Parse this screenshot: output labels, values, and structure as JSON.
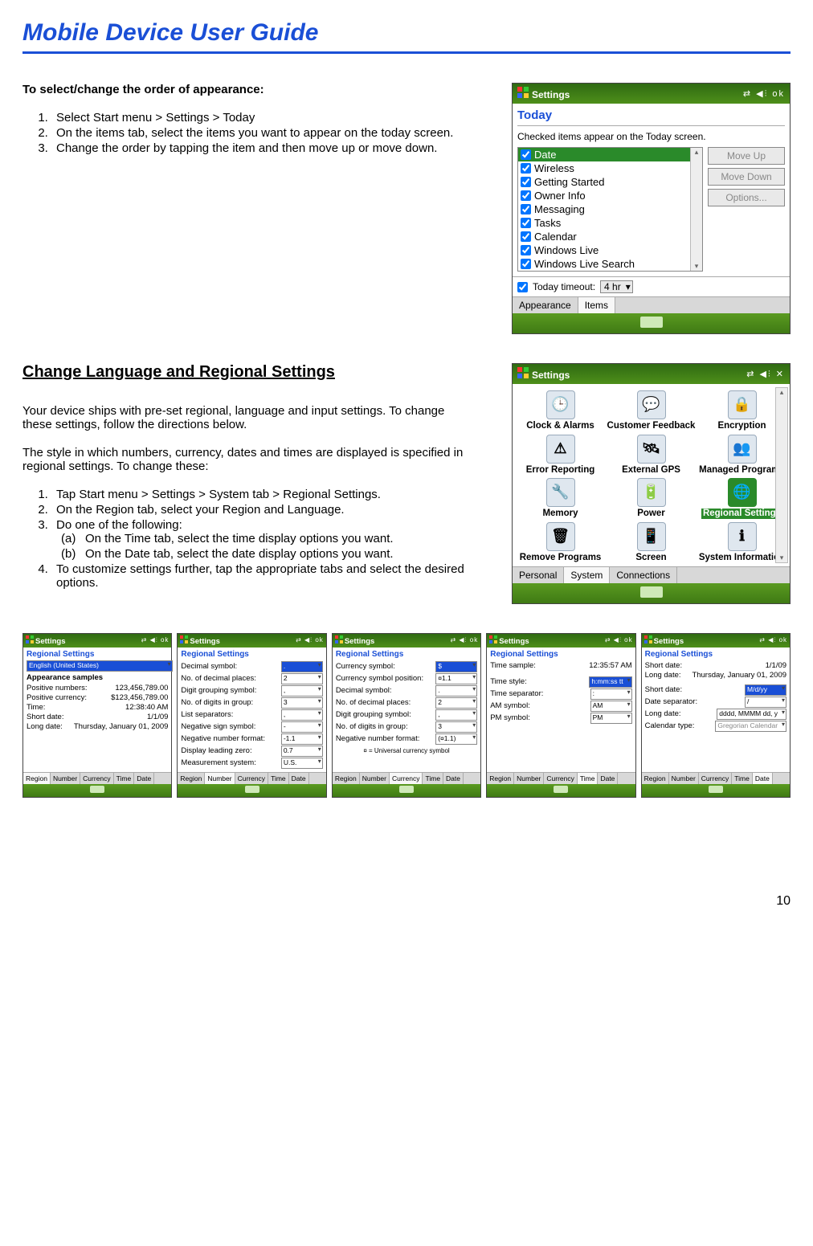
{
  "page": {
    "title": "Mobile Device User Guide",
    "number": "10"
  },
  "section1": {
    "heading": "To select/change the order of appearance:",
    "steps": [
      "Select Start menu > Settings > Today",
      "On the items tab, select the items you want to appear on the today screen.",
      "Change the order by tapping the item and then move up or move down."
    ]
  },
  "device1": {
    "title": "Settings",
    "rightIcons": "⇄  ◀⫶  ok",
    "subtitle": "Today",
    "caption": "Checked items appear on the Today screen.",
    "items": [
      "Date",
      "Wireless",
      "Getting Started",
      "Owner Info",
      "Messaging",
      "Tasks",
      "Calendar",
      "Windows Live",
      "Windows Live Search"
    ],
    "buttons": [
      "Move Up",
      "Move Down",
      "Options..."
    ],
    "footerLabel": "Today timeout:",
    "footerValue": "4 hr",
    "tabs": [
      "Appearance",
      "Items"
    ]
  },
  "section2": {
    "heading": "Change Language and Regional Settings",
    "p1": "Your device ships with pre-set regional, language and input settings. To change",
    "p1b": "these settings, follow the directions below.",
    "p2": "The style in which numbers, currency, dates and times are displayed is specified in regional settings. To change these:",
    "steps": [
      "Tap Start menu > Settings > System tab > Regional Settings.",
      "On the Region tab, select your Region and Language.",
      "Do one of the following:",
      "To customize settings further, tap the appropriate tabs and select the desired options."
    ],
    "substeps": [
      {
        "label": "(a)",
        "text": "On the Time tab, select the time display options you want."
      },
      {
        "label": "(b)",
        "text": "On the Date tab, select the date display options you want."
      }
    ]
  },
  "device2": {
    "title": "Settings",
    "rightIcons": "⇄  ◀⫶  ✕",
    "grid": [
      "Clock & Alarms",
      "Customer Feedback",
      "Encryption",
      "Error Reporting",
      "External GPS",
      "Managed Programs",
      "Memory",
      "Power",
      "Regional Settings",
      "Remove Programs",
      "Screen",
      "System Information"
    ],
    "gridIcons": [
      "🕒",
      "💬",
      "🔒",
      "⚠",
      "🛰",
      "👥",
      "🔧",
      "🔋",
      "🌐",
      "🗑",
      "📱",
      "ℹ"
    ],
    "tabs": [
      "Personal",
      "System",
      "Connections"
    ]
  },
  "shots": {
    "common": {
      "title": "Settings",
      "rightIcons": "⇄ ◀⫶ ok",
      "subtitle": "Regional Settings",
      "tabs": [
        "Region",
        "Number",
        "Currency",
        "Time",
        "Date"
      ]
    },
    "s1": {
      "dropdown": "English (United States)",
      "head": "Appearance samples",
      "rows": [
        [
          "Positive numbers:",
          "123,456,789.00"
        ],
        [
          "Positive currency:",
          "$123,456,789.00"
        ],
        [
          "Time:",
          "12:38:40 AM"
        ],
        [
          "Short date:",
          "1/1/09"
        ],
        [
          "Long date:",
          "Thursday, January 01, 2009"
        ]
      ]
    },
    "s2": {
      "rows": [
        [
          "Decimal symbol:",
          "."
        ],
        [
          "No. of decimal places:",
          "2"
        ],
        [
          "Digit grouping symbol:",
          ","
        ],
        [
          "No. of digits in group:",
          "3"
        ],
        [
          "List separators:",
          ","
        ],
        [
          "Negative sign symbol:",
          "-"
        ],
        [
          "Negative number format:",
          "-1.1"
        ],
        [
          "Display leading zero:",
          "0.7"
        ],
        [
          "Measurement system:",
          "U.S."
        ]
      ]
    },
    "s3": {
      "rows": [
        [
          "Currency symbol:",
          "$"
        ],
        [
          "Currency symbol position:",
          "¤1.1"
        ],
        [
          "Decimal symbol:",
          "."
        ],
        [
          "No. of decimal places:",
          "2"
        ],
        [
          "Digit grouping symbol:",
          ","
        ],
        [
          "No. of digits in group:",
          "3"
        ],
        [
          "Negative number format:",
          "(¤1.1)"
        ]
      ],
      "note": "¤ = Universal currency symbol"
    },
    "s4": {
      "sampleLabel": "Time sample:",
      "sampleValue": "12:35:57 AM",
      "rows": [
        [
          "Time style:",
          "h:mm:ss tt"
        ],
        [
          "Time separator:",
          ":"
        ],
        [
          "AM symbol:",
          "AM"
        ],
        [
          "PM symbol:",
          "PM"
        ]
      ]
    },
    "s5": {
      "top": [
        [
          "Short date:",
          "1/1/09"
        ],
        [
          "Long date:",
          "Thursday, January 01, 2009"
        ]
      ],
      "rows": [
        [
          "Short date:",
          "M/d/yy"
        ],
        [
          "Date separator:",
          "/"
        ],
        [
          "Long date:",
          "dddd, MMMM dd, y"
        ],
        [
          "Calendar type:",
          "Gregorian Calendar"
        ]
      ]
    }
  }
}
